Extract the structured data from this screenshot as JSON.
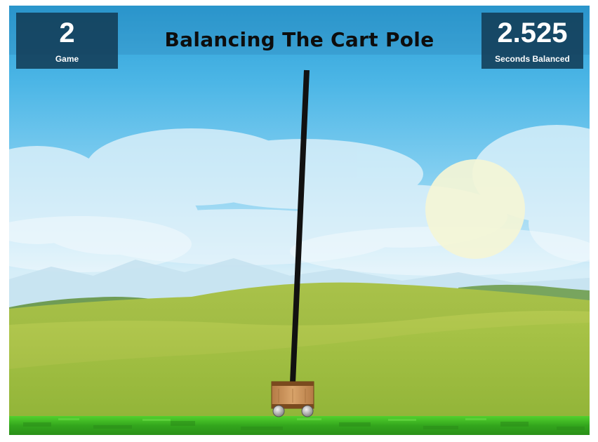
{
  "game": {
    "title": "Balancing The Cart Pole",
    "game_number": {
      "value": "2",
      "label": "Game"
    },
    "seconds_balanced": {
      "value": "2.525",
      "label": "Seconds Balanced"
    }
  },
  "colors": {
    "score_box_bg": "#123c56",
    "title_text": "#0d0d0d",
    "pole": "#111111",
    "grass": "#3fbf24",
    "cart_wood": "#c8925a"
  },
  "icons": {
    "sun": "sun-icon",
    "cart": "cart-icon",
    "pole": "pole-icon"
  }
}
